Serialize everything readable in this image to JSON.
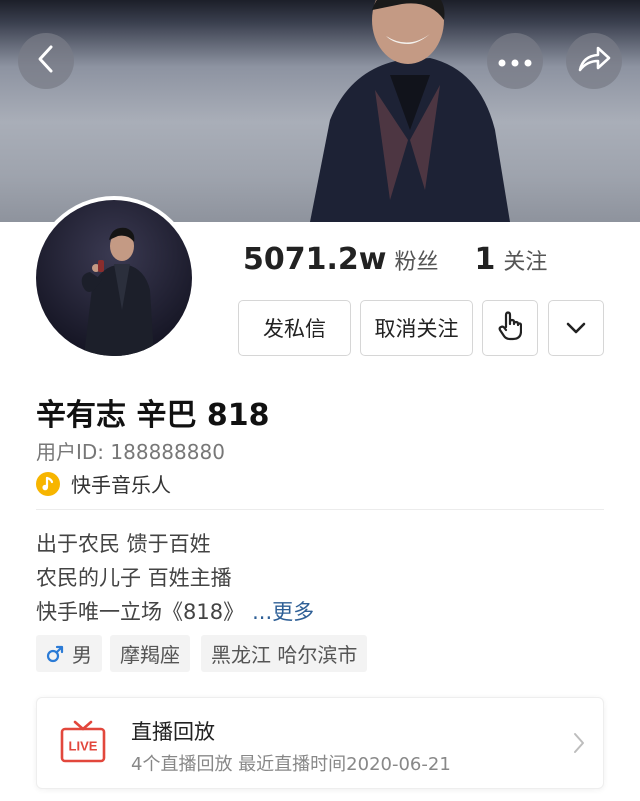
{
  "header": {
    "back_icon": "chevron-left-icon",
    "more_icon": "ellipsis-icon",
    "share_icon": "share-arrow-icon"
  },
  "stats": {
    "followers_count": "5071.2w",
    "followers_label": "粉丝",
    "following_count": "1",
    "following_label": "关注"
  },
  "actions": {
    "message_label": "发私信",
    "unfollow_label": "取消关注",
    "touch_icon": "hand-tap-icon",
    "dropdown_icon": "chevron-down-icon"
  },
  "profile": {
    "name": "辛有志 辛巴 818",
    "user_id": "用户ID: 188888880",
    "badge_label": "快手音乐人",
    "badge_icon": "music-note-icon",
    "badge_color": "#f7b500"
  },
  "bio": {
    "line1": "出于农民 馈于百姓",
    "line2": "农民的儿子  百姓主播",
    "line3": "快手唯一立场《818》",
    "more_label": "...更多",
    "more_color": "#2e5f96"
  },
  "tags": {
    "gender": "男",
    "gender_icon": "male-symbol-icon",
    "gender_color": "#2b7bd6",
    "zodiac": "摩羯座",
    "location": "黑龙江 哈尔滨市"
  },
  "live_replay": {
    "title": "直播回放",
    "subtitle": "4个直播回放 最近直播时间2020-06-21",
    "icon": "live-tv-icon",
    "icon_text": "LIVE",
    "icon_color": "#e2473c"
  }
}
